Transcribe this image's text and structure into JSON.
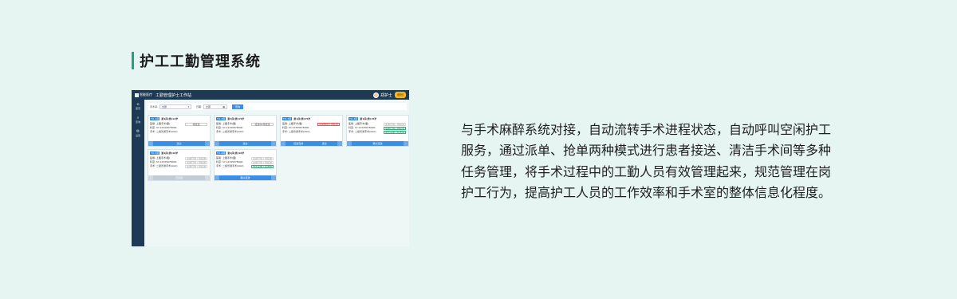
{
  "section": {
    "title": "护工工勤管理系统"
  },
  "screenshot": {
    "app_name": "智能医疗",
    "window_title": "工勤管理护士工作站",
    "user_name": "郑护士",
    "exit_label": "退出",
    "nav": [
      {
        "icon": "home-icon",
        "glyph": "⌂",
        "label": "首页"
      },
      {
        "icon": "search-icon",
        "glyph": "⌕",
        "label": "查询"
      },
      {
        "icon": "gear-icon",
        "glyph": "⚙",
        "label": "设置"
      }
    ],
    "filter": {
      "label1": "手术间:",
      "select_value": "全部",
      "label2": "日期:",
      "date_value": "全部",
      "button": "查询"
    },
    "cards": [
      {
        "room": "TO-1床",
        "name": "第1床(男)12岁",
        "line1": "医嘱: 上腹手术(腹)",
        "line2": "科室: SY-12345678000",
        "line3": "手术: 二级普通手术(AG0)",
        "status": "待接送",
        "status_type": "normal",
        "footer": "送达",
        "footer_type": "blue"
      },
      {
        "room": "TO-2床",
        "name": "第1床(男)15岁",
        "line1": "医嘱: 上腹手术(腹)",
        "line2": "科室: SY-12345678000",
        "line3": "手术: 二级普通手术(AG0)",
        "status": "接送中/待接送",
        "status_type": "normal",
        "footer": "送达",
        "footer_type": "blue"
      },
      {
        "room": "TO-3床",
        "name": "第1床(男)15岁",
        "line1": "医嘱: 上腹手术(腹)",
        "line2": "科室: SY-12345678000",
        "line3": "手术: 二级普通手术(AG0)",
        "status": "患者未到 / 待接送",
        "status_type": "red",
        "footer": "送达",
        "footer_type": "blue",
        "footer_left": "接送完成"
      },
      {
        "room": "TO-4床",
        "name": "第1床(男)15岁",
        "line1": "医嘱: 上腹手术(腹)",
        "line2": "科室: SY-12345678000",
        "line3": "手术: 二级普通手术(AG0)",
        "status": "患者已到 / 待接送",
        "status_type": "gray",
        "status2": "患者已到 / 待接送",
        "status3": "送达完成 / 接送中",
        "footer": "确认接送",
        "footer_type": "blue"
      },
      {
        "room": "TO-5床",
        "name": "第1床(男)16岁",
        "line1": "医嘱: 上腹手术(腹)",
        "line2": "科室: SY-12345678000",
        "line3": "手术: 二级普通手术(AG0)",
        "status": "患者已到 / 待接送",
        "status_type": "gray",
        "status2": "患者已到 / 待接送",
        "status3": "患者已到 / 待接送",
        "footer": "已完成",
        "footer_type": "gray"
      },
      {
        "room": "TO-6床",
        "name": "第1床(男)16岁",
        "line1": "医嘱: 上腹手术(腹)",
        "line2": "科室: SY-12345678000",
        "line3": "手术: 二级普通手术(AG0)",
        "status": "患者已到 / 待接送",
        "status_type": "gray",
        "status2": "患者已到 / 待接送",
        "status3": "送达完成 / 接送中",
        "footer": "确认接送",
        "footer_type": "blue"
      }
    ]
  },
  "description": "与手术麻醉系统对接，自动流转手术进程状态，自动呼叫空闲护工服务，通过派单、抢单两种模式进行患者接送、清洁手术间等多种任务管理，将手术过程中的工勤人员有效管理起来，规范管理在岗护工行为，提高护工人员的工作效率和手术室的整体信息化程度。"
}
